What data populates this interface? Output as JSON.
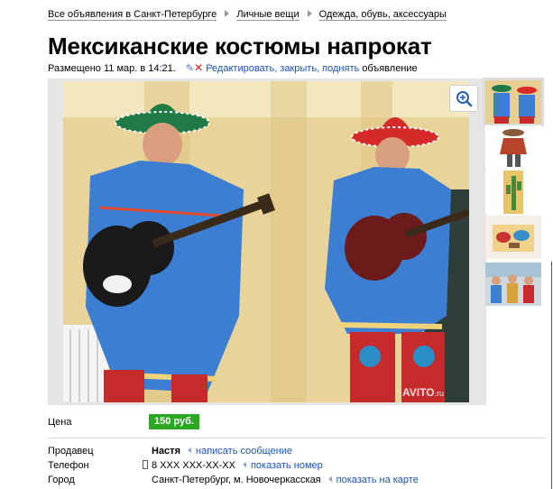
{
  "breadcrumb": {
    "items": [
      "Все объявления в Санкт-Петербурге",
      "Личные вещи",
      "Одежда, обувь, аксессуары"
    ]
  },
  "ad": {
    "title": "Мексиканские костюмы напрокат",
    "posted": "Размещено 11 мар. в 14:21.",
    "edit_link": "Редактировать, закрыть, поднять",
    "edit_suffix": "объявление"
  },
  "gallery": {
    "watermark": "AVITO",
    "watermark_suffix": ".ru",
    "zoom_icon": "magnifier-plus-icon",
    "thumbnail_count": 5,
    "selected_thumbnail": 1
  },
  "details": {
    "price_label": "Цена",
    "price_value": "150 руб.",
    "seller_label": "Продавец",
    "seller_name": "Настя",
    "seller_action": "написать сообщение",
    "phone_label": "Телефон",
    "phone_value": "8 XXX XXX-XX-XX",
    "phone_action": "показать номер",
    "city_label": "Город",
    "city_value": "Санкт-Петербург, м. Новочеркасская",
    "city_action": "показать на карте"
  },
  "colors": {
    "price_badge": "#2ba822",
    "link": "#1b56b8",
    "delete_icon": "#e01a1a"
  }
}
